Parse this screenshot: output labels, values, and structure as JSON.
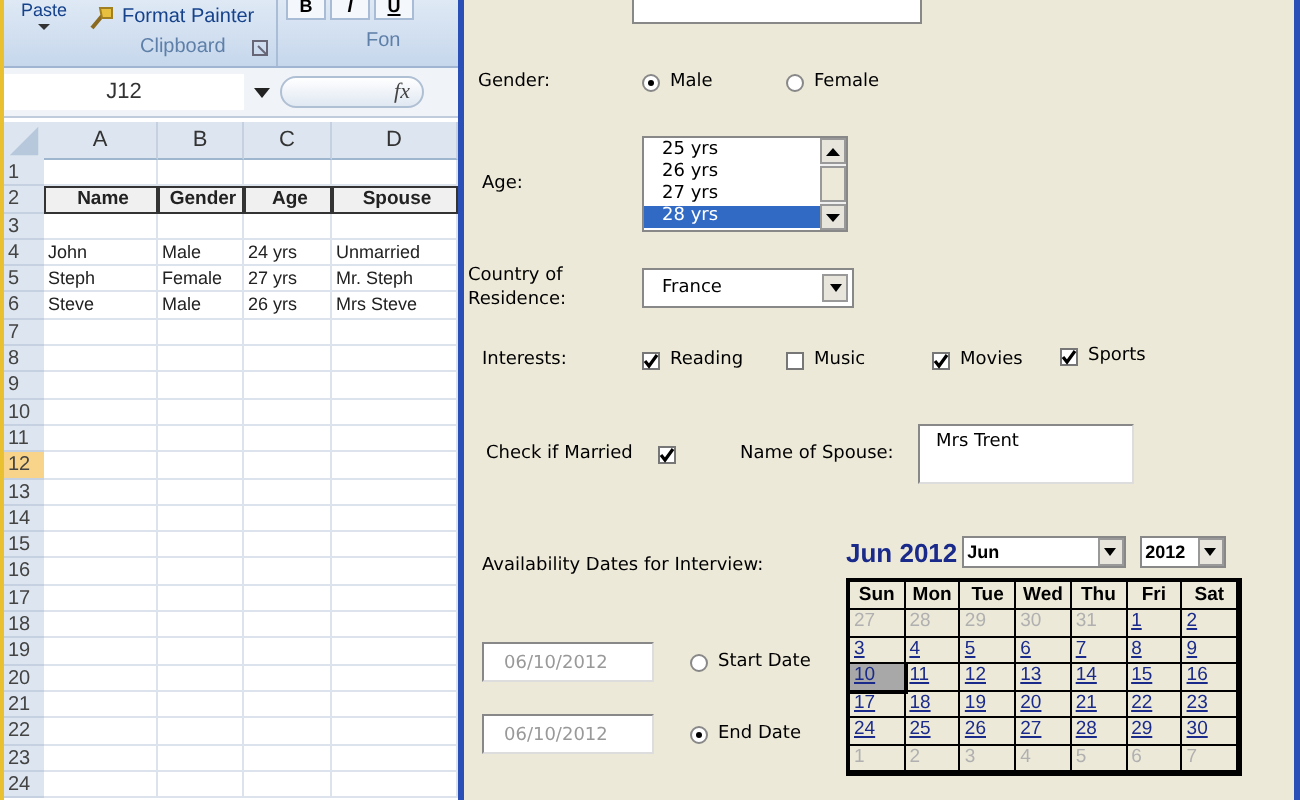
{
  "ribbon": {
    "paste_label": "Paste",
    "format_painter": "Format Painter",
    "group_label": "Clipboard",
    "font_group_label": "Fon",
    "font_buttons": [
      "B",
      "I",
      "U"
    ]
  },
  "formula_bar": {
    "name_box": "J12",
    "fx": "fx"
  },
  "sheet": {
    "columns": [
      {
        "label": "A",
        "selected": false
      },
      {
        "label": "B",
        "selected": false
      },
      {
        "label": "C",
        "selected": false
      },
      {
        "label": "D",
        "selected": false
      }
    ],
    "rows": [
      {
        "number": "1",
        "selected": false,
        "header": false,
        "cells": []
      },
      {
        "number": "2",
        "selected": false,
        "header": true,
        "cells": [
          "Name",
          "Gender",
          "Age",
          "Spouse"
        ]
      },
      {
        "number": "3",
        "selected": false,
        "header": false,
        "cells": []
      },
      {
        "number": "4",
        "selected": false,
        "header": false,
        "cells": [
          "John",
          "Male",
          "24 yrs",
          "Unmarried"
        ]
      },
      {
        "number": "5",
        "selected": false,
        "header": false,
        "cells": [
          "Steph",
          "Female",
          "27 yrs",
          "Mr. Steph"
        ]
      },
      {
        "number": "6",
        "selected": false,
        "header": false,
        "cells": [
          "Steve",
          "Male",
          "26 yrs",
          "Mrs Steve"
        ]
      },
      {
        "number": "7",
        "selected": false,
        "header": false,
        "cells": []
      },
      {
        "number": "8",
        "selected": false,
        "header": false,
        "cells": []
      },
      {
        "number": "9",
        "selected": false,
        "header": false,
        "cells": []
      },
      {
        "number": "10",
        "selected": false,
        "header": false,
        "cells": []
      },
      {
        "number": "11",
        "selected": false,
        "header": false,
        "cells": []
      },
      {
        "number": "12",
        "selected": true,
        "header": false,
        "cells": []
      },
      {
        "number": "13",
        "selected": false,
        "header": false,
        "cells": []
      },
      {
        "number": "14",
        "selected": false,
        "header": false,
        "cells": []
      },
      {
        "number": "15",
        "selected": false,
        "header": false,
        "cells": []
      },
      {
        "number": "16",
        "selected": false,
        "header": false,
        "cells": []
      },
      {
        "number": "17",
        "selected": false,
        "header": false,
        "cells": []
      },
      {
        "number": "18",
        "selected": false,
        "header": false,
        "cells": []
      },
      {
        "number": "19",
        "selected": false,
        "header": false,
        "cells": []
      },
      {
        "number": "20",
        "selected": false,
        "header": false,
        "cells": []
      },
      {
        "number": "21",
        "selected": false,
        "header": false,
        "cells": []
      },
      {
        "number": "22",
        "selected": false,
        "header": false,
        "cells": []
      },
      {
        "number": "23",
        "selected": false,
        "header": false,
        "cells": []
      },
      {
        "number": "24",
        "selected": false,
        "header": false,
        "cells": []
      }
    ]
  },
  "form": {
    "gender": {
      "label": "Gender:",
      "options": [
        {
          "label": "Male",
          "selected": true
        },
        {
          "label": "Female",
          "selected": false
        }
      ]
    },
    "age": {
      "label": "Age:",
      "items": [
        {
          "label": "25 yrs",
          "selected": false
        },
        {
          "label": "26 yrs",
          "selected": false
        },
        {
          "label": "27 yrs",
          "selected": false
        },
        {
          "label": "28 yrs",
          "selected": true
        }
      ]
    },
    "country": {
      "label": "Country of Residence:",
      "value": "France"
    },
    "interests": {
      "label": "Interests:",
      "options": [
        {
          "label": "Reading",
          "checked": true
        },
        {
          "label": "Music",
          "checked": false
        },
        {
          "label": "Movies",
          "checked": true
        },
        {
          "label": "Sports",
          "checked": true
        }
      ]
    },
    "married": {
      "label": "Check if Married",
      "checked": true
    },
    "spouse": {
      "label": "Name of Spouse:",
      "value": "Mrs Trent"
    },
    "availability": {
      "label": "Availability Dates for Interview:",
      "dates": [
        {
          "value": "06/10/2012",
          "disabled": true,
          "label": "Start Date",
          "selected": false
        },
        {
          "value": "06/10/2012",
          "disabled": true,
          "label": "End Date",
          "selected": true
        }
      ]
    },
    "calendar": {
      "title": "Jun 2012",
      "month": "Jun",
      "year": "2012",
      "weekdays": [
        "Sun",
        "Mon",
        "Tue",
        "Wed",
        "Thu",
        "Fri",
        "Sat"
      ],
      "weeks": [
        [
          {
            "day": "27",
            "outside": true,
            "selected": false
          },
          {
            "day": "28",
            "outside": true,
            "selected": false
          },
          {
            "day": "29",
            "outside": true,
            "selected": false
          },
          {
            "day": "30",
            "outside": true,
            "selected": false
          },
          {
            "day": "31",
            "outside": true,
            "selected": false
          },
          {
            "day": "1",
            "outside": false,
            "selected": false
          },
          {
            "day": "2",
            "outside": false,
            "selected": false
          }
        ],
        [
          {
            "day": "3",
            "outside": false,
            "selected": false
          },
          {
            "day": "4",
            "outside": false,
            "selected": false
          },
          {
            "day": "5",
            "outside": false,
            "selected": false
          },
          {
            "day": "6",
            "outside": false,
            "selected": false
          },
          {
            "day": "7",
            "outside": false,
            "selected": false
          },
          {
            "day": "8",
            "outside": false,
            "selected": false
          },
          {
            "day": "9",
            "outside": false,
            "selected": false
          }
        ],
        [
          {
            "day": "10",
            "outside": false,
            "selected": true
          },
          {
            "day": "11",
            "outside": false,
            "selected": false
          },
          {
            "day": "12",
            "outside": false,
            "selected": false
          },
          {
            "day": "13",
            "outside": false,
            "selected": false
          },
          {
            "day": "14",
            "outside": false,
            "selected": false
          },
          {
            "day": "15",
            "outside": false,
            "selected": false
          },
          {
            "day": "16",
            "outside": false,
            "selected": false
          }
        ],
        [
          {
            "day": "17",
            "outside": false,
            "selected": false
          },
          {
            "day": "18",
            "outside": false,
            "selected": false
          },
          {
            "day": "19",
            "outside": false,
            "selected": false
          },
          {
            "day": "20",
            "outside": false,
            "selected": false
          },
          {
            "day": "21",
            "outside": false,
            "selected": false
          },
          {
            "day": "22",
            "outside": false,
            "selected": false
          },
          {
            "day": "23",
            "outside": false,
            "selected": false
          }
        ],
        [
          {
            "day": "24",
            "outside": false,
            "selected": false
          },
          {
            "day": "25",
            "outside": false,
            "selected": false
          },
          {
            "day": "26",
            "outside": false,
            "selected": false
          },
          {
            "day": "27",
            "outside": false,
            "selected": false
          },
          {
            "day": "28",
            "outside": false,
            "selected": false
          },
          {
            "day": "29",
            "outside": false,
            "selected": false
          },
          {
            "day": "30",
            "outside": false,
            "selected": false
          }
        ],
        [
          {
            "day": "1",
            "outside": true,
            "selected": false
          },
          {
            "day": "2",
            "outside": true,
            "selected": false
          },
          {
            "day": "3",
            "outside": true,
            "selected": false
          },
          {
            "day": "4",
            "outside": true,
            "selected": false
          },
          {
            "day": "5",
            "outside": true,
            "selected": false
          },
          {
            "day": "6",
            "outside": true,
            "selected": false
          },
          {
            "day": "7",
            "outside": true,
            "selected": false
          }
        ]
      ]
    }
  }
}
